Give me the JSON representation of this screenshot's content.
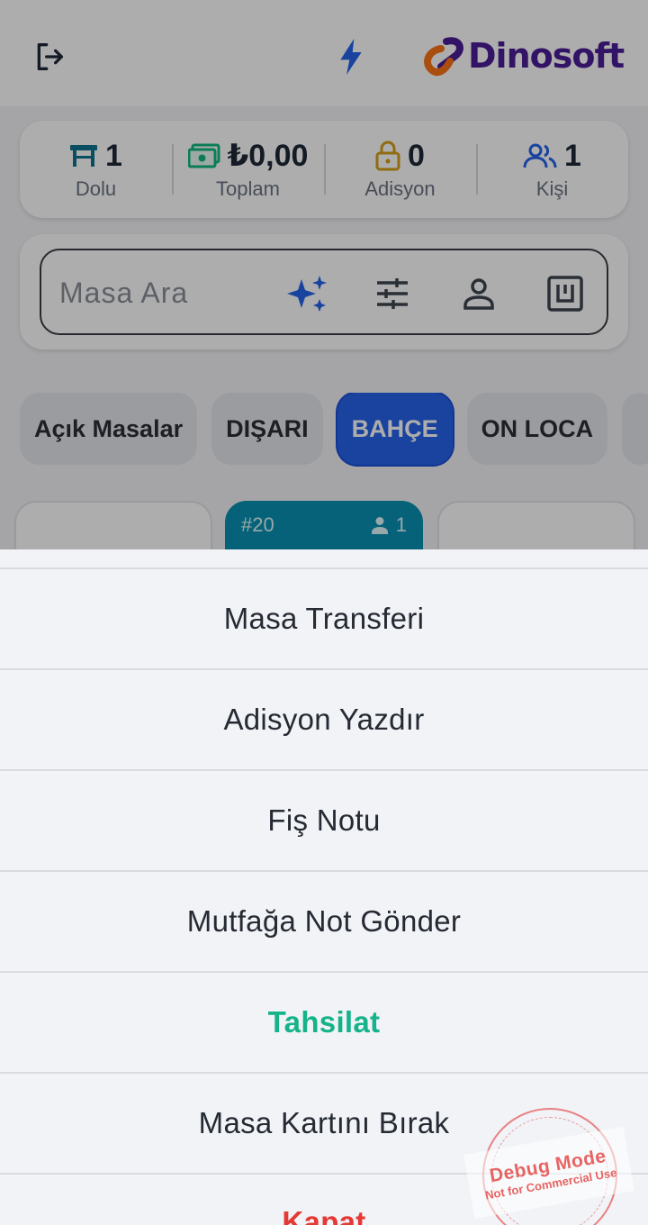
{
  "header": {
    "logout_icon": "logout-icon",
    "bolt_icon": "lightning-bolt-icon",
    "logo_text": "Dinosoft",
    "colors": {
      "bolt": "#2563eb",
      "logo_text": "#4c1d95",
      "logo_orange": "#f97316"
    }
  },
  "stats": [
    {
      "icon": "table-icon",
      "value": "1",
      "label": "Dolu",
      "color": "#0e7490"
    },
    {
      "icon": "money-icon",
      "value": "₺0,00",
      "label": "Toplam",
      "color": "#10b981"
    },
    {
      "icon": "lock-icon",
      "value": "0",
      "label": "Adisyon",
      "color": "#d4a017"
    },
    {
      "icon": "users-icon",
      "value": "1",
      "label": "Kişi",
      "color": "#2563eb"
    }
  ],
  "search": {
    "placeholder": "Masa Ara",
    "icons": [
      "sparkle-icon",
      "filter-sliders-icon",
      "person-icon",
      "card-icon"
    ]
  },
  "categories": [
    {
      "label": "Açık Masalar",
      "active": false
    },
    {
      "label": "DIŞARI",
      "active": false
    },
    {
      "label": "BAHÇE",
      "active": true
    },
    {
      "label": "ON LOCA",
      "active": false
    }
  ],
  "tables": [
    {
      "number": "",
      "people": "",
      "occupied": false
    },
    {
      "number": "#20",
      "people": "1",
      "occupied": true
    },
    {
      "number": "",
      "people": "",
      "occupied": false
    }
  ],
  "action_sheet": {
    "items": [
      {
        "label": "Masa Transferi",
        "style": "default"
      },
      {
        "label": "Adisyon Yazdır",
        "style": "default"
      },
      {
        "label": "Fiş Notu",
        "style": "default"
      },
      {
        "label": "Mutfağa Not Gönder",
        "style": "default"
      },
      {
        "label": "Tahsilat",
        "style": "success"
      },
      {
        "label": "Masa Kartını Bırak",
        "style": "default"
      },
      {
        "label": "Kapat",
        "style": "danger"
      }
    ]
  },
  "debug_stamp": {
    "title": "Debug Mode",
    "subtitle": "Not for Commercial Use"
  }
}
